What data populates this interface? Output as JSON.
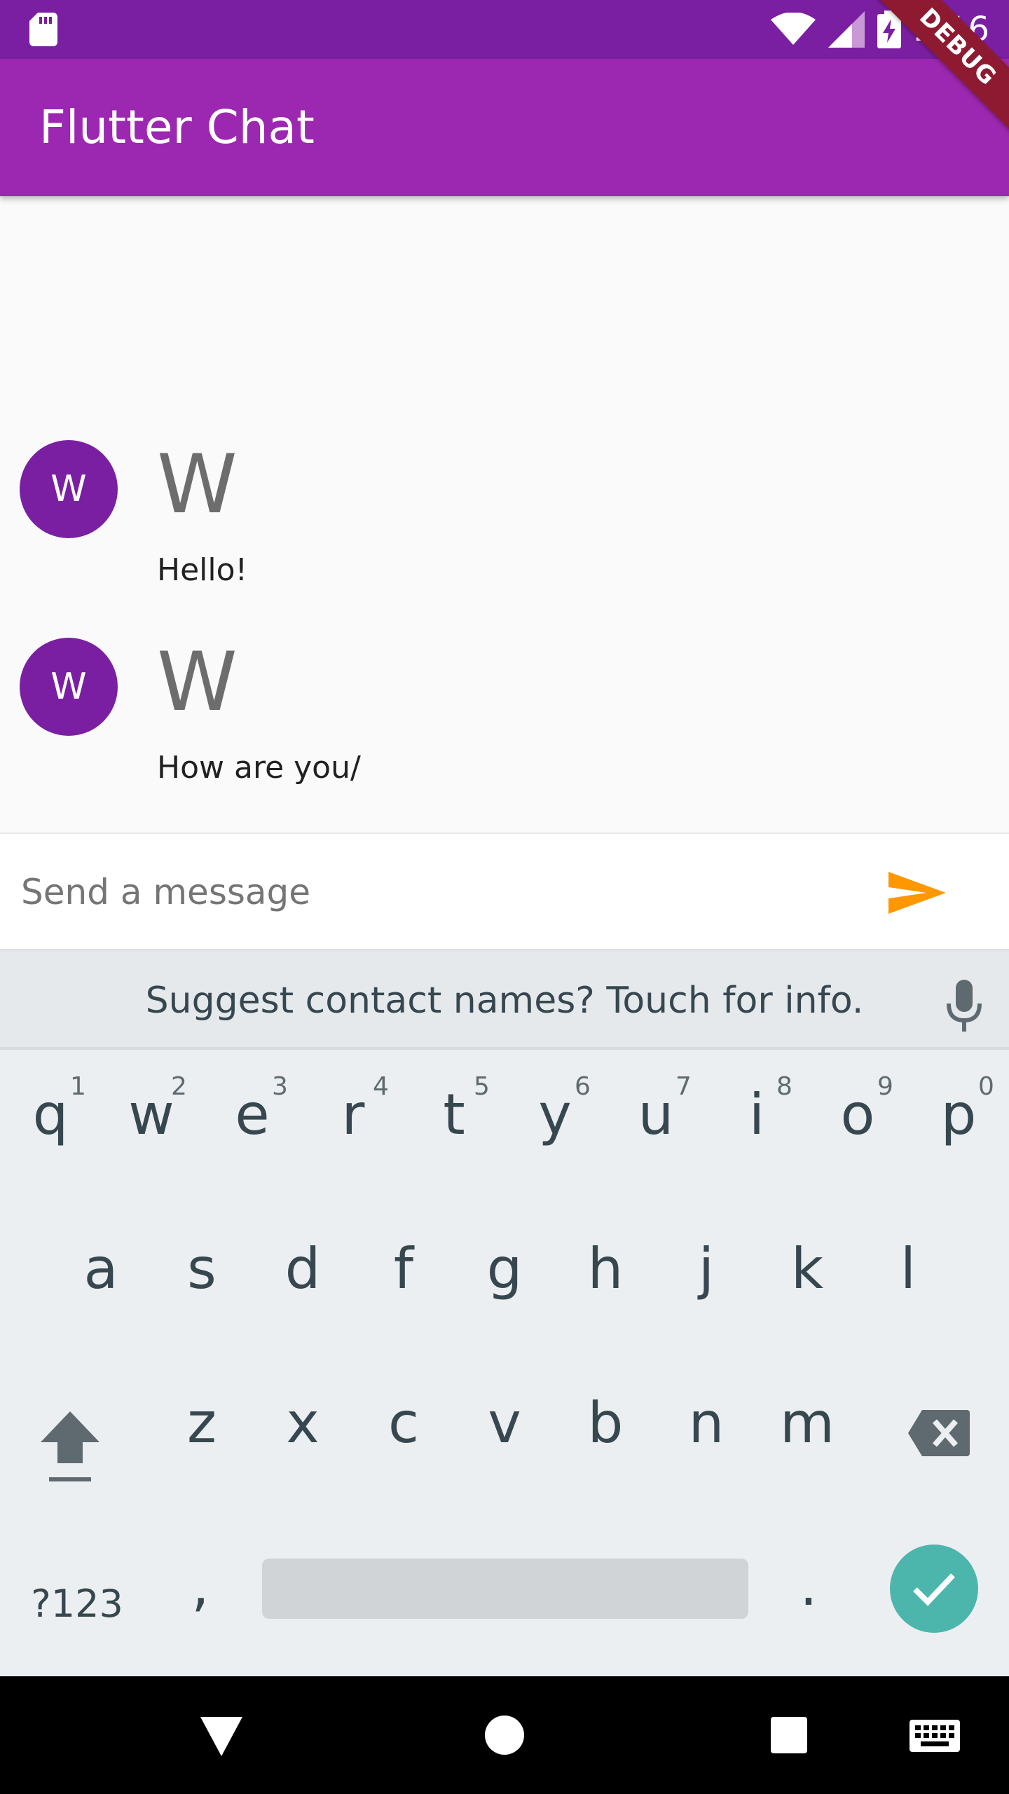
{
  "status_bar": {
    "time": "2:16"
  },
  "debug_banner": {
    "label": "DEBUG"
  },
  "app_bar": {
    "title": "Flutter Chat"
  },
  "messages": [
    {
      "avatar_initial": "W",
      "sender": "W",
      "text": "Hello!"
    },
    {
      "avatar_initial": "W",
      "sender": "W",
      "text": "How are you/"
    }
  ],
  "composer": {
    "placeholder": "Send a message",
    "send_color": "#ff9800"
  },
  "keyboard": {
    "suggestion": "Suggest contact names? Touch for info.",
    "row1": [
      {
        "key": "q",
        "hint": "1"
      },
      {
        "key": "w",
        "hint": "2"
      },
      {
        "key": "e",
        "hint": "3"
      },
      {
        "key": "r",
        "hint": "4"
      },
      {
        "key": "t",
        "hint": "5"
      },
      {
        "key": "y",
        "hint": "6"
      },
      {
        "key": "u",
        "hint": "7"
      },
      {
        "key": "i",
        "hint": "8"
      },
      {
        "key": "o",
        "hint": "9"
      },
      {
        "key": "p",
        "hint": "0"
      }
    ],
    "row2": [
      "a",
      "s",
      "d",
      "f",
      "g",
      "h",
      "j",
      "k",
      "l"
    ],
    "row3": [
      "z",
      "x",
      "c",
      "v",
      "b",
      "n",
      "m"
    ],
    "symbols_label": "?123",
    "comma": ",",
    "period": ".",
    "accent_color": "#4db6ac"
  },
  "colors": {
    "status_bar": "#7b1fa2",
    "app_bar": "#9c27b0",
    "avatar": "#7b1fa2"
  },
  "icons": [
    "sd-card-icon",
    "wifi-icon",
    "signal-icon",
    "battery-charging-icon",
    "send-icon",
    "mic-icon",
    "shift-icon",
    "backspace-icon",
    "check-icon",
    "back-icon",
    "home-icon",
    "recents-icon",
    "keyboard-icon"
  ]
}
